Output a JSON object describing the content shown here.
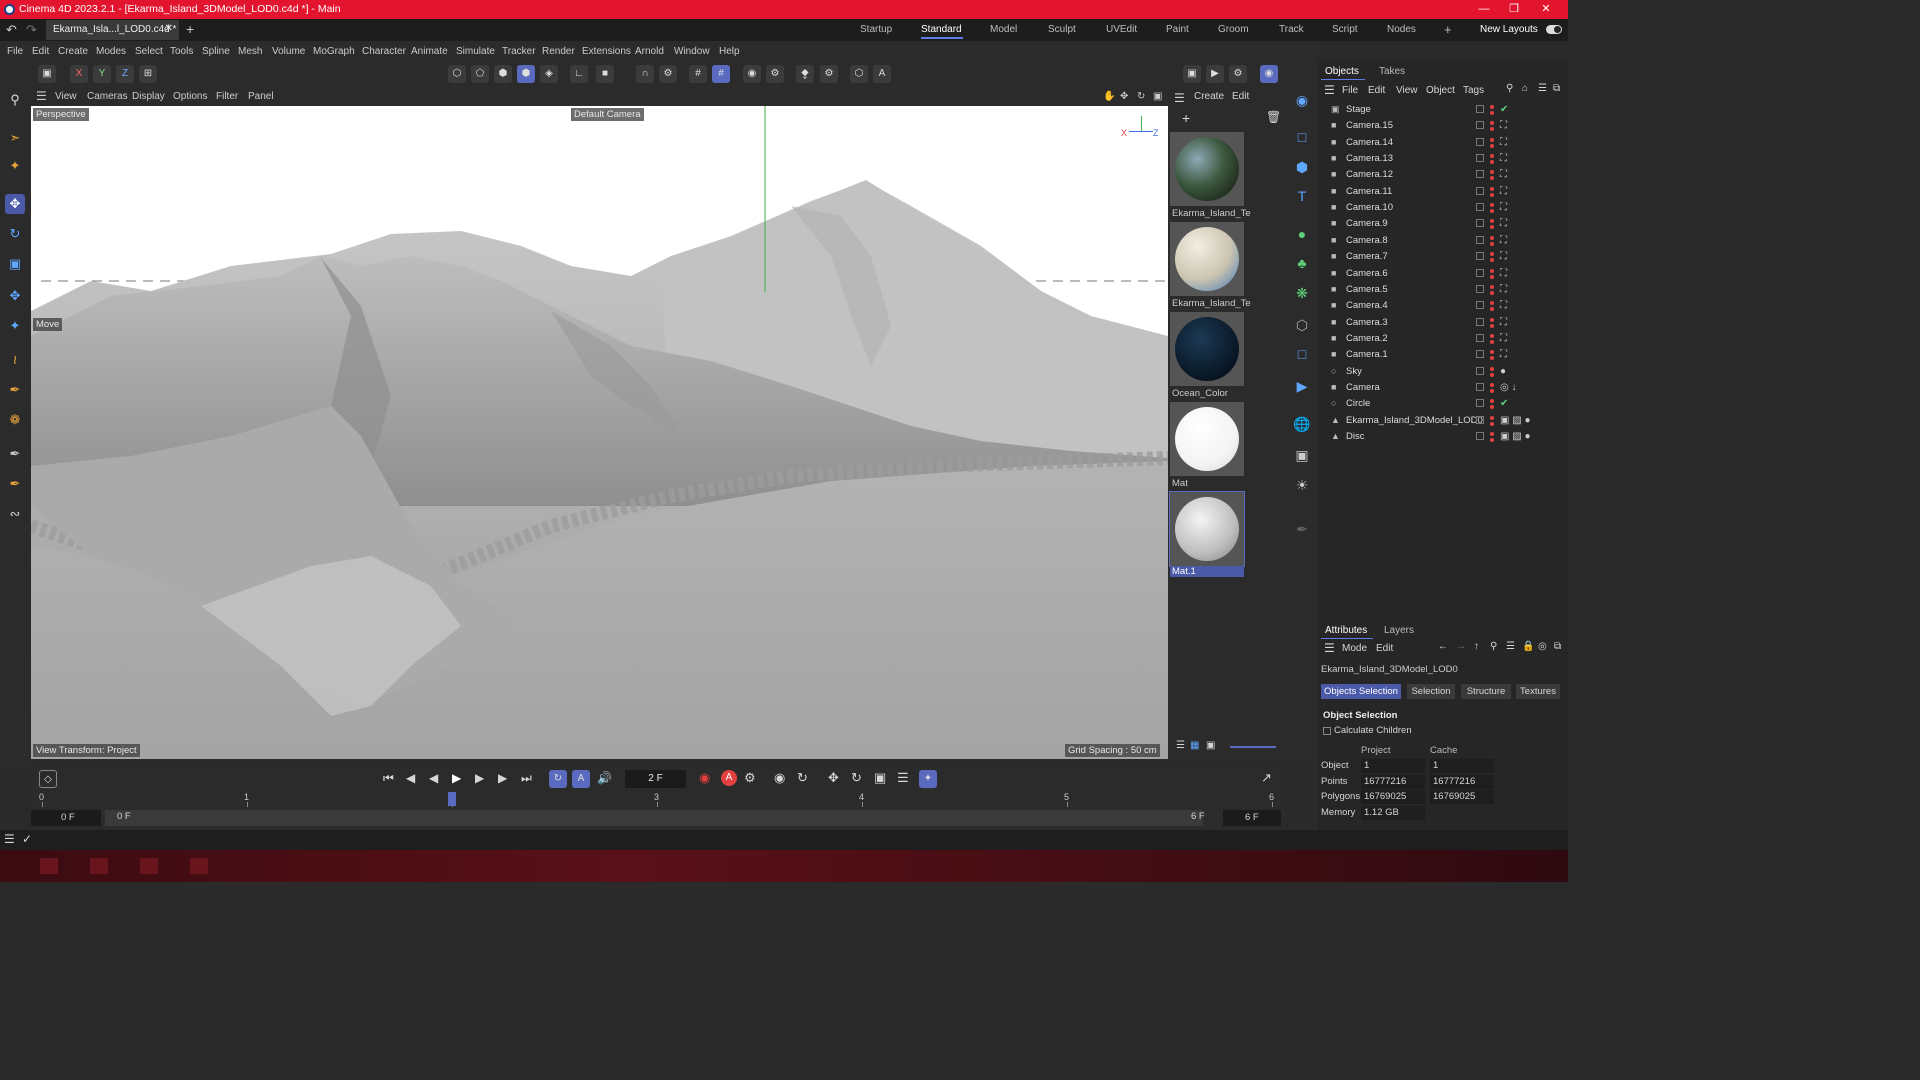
{
  "title_bar": {
    "title": "Cinema 4D 2023.2.1 - [Ekarma_Island_3DModel_LOD0.c4d *] - Main"
  },
  "doc_tab": {
    "label": "Ekarma_Isla...l_LOD0.c4d *"
  },
  "layouts": {
    "items": [
      "Startup",
      "Standard",
      "Model",
      "Sculpt",
      "UVEdit",
      "Paint",
      "Groom",
      "Track",
      "Script",
      "Nodes"
    ],
    "active": "Standard",
    "new_layouts": "New Layouts"
  },
  "menu": {
    "items": [
      "File",
      "Edit",
      "Create",
      "Modes",
      "Select",
      "Tools",
      "Spline",
      "Mesh",
      "Volume",
      "MoGraph",
      "Character",
      "Animate",
      "Simulate",
      "Tracker",
      "Render",
      "Extensions",
      "Arnold",
      "Window",
      "Help"
    ]
  },
  "axis_buttons": [
    "X",
    "Y",
    "Z"
  ],
  "viewport_menu": {
    "items": [
      "View",
      "Cameras",
      "Display",
      "Options",
      "Filter",
      "Panel"
    ]
  },
  "viewport": {
    "camera_label": "Perspective",
    "default_camera": "Default Camera",
    "move_label": "Move",
    "view_transform": "View Transform: Project",
    "grid_spacing": "Grid Spacing : 50 cm",
    "axis_x": "X",
    "axis_z": "Z"
  },
  "materials_panel": {
    "menu": [
      "Create",
      "Edit"
    ],
    "materials": [
      {
        "name": "Ekarma_Island_Te",
        "style": "island"
      },
      {
        "name": "Ekarma_Island_Te",
        "style": "island2"
      },
      {
        "name": "Ocean_Color",
        "style": "ocean"
      },
      {
        "name": "Mat",
        "style": "white"
      },
      {
        "name": "Mat.1",
        "style": "grey"
      }
    ]
  },
  "objects_panel": {
    "tabs": [
      "Objects",
      "Takes"
    ],
    "menu": [
      "File",
      "Edit",
      "View",
      "Object",
      "Tags"
    ],
    "objects": [
      {
        "name": "Stage",
        "icon": "stage-icon",
        "tag": "check"
      },
      {
        "name": "Camera.15",
        "icon": "camera-icon",
        "tag": "target"
      },
      {
        "name": "Camera.14",
        "icon": "camera-icon",
        "tag": "target"
      },
      {
        "name": "Camera.13",
        "icon": "camera-icon",
        "tag": "target"
      },
      {
        "name": "Camera.12",
        "icon": "camera-icon",
        "tag": "target"
      },
      {
        "name": "Camera.11",
        "icon": "camera-icon",
        "tag": "target"
      },
      {
        "name": "Camera.10",
        "icon": "camera-icon",
        "tag": "target"
      },
      {
        "name": "Camera.9",
        "icon": "camera-icon",
        "tag": "target"
      },
      {
        "name": "Camera.8",
        "icon": "camera-icon",
        "tag": "target"
      },
      {
        "name": "Camera.7",
        "icon": "camera-icon",
        "tag": "target"
      },
      {
        "name": "Camera.6",
        "icon": "camera-icon",
        "tag": "target"
      },
      {
        "name": "Camera.5",
        "icon": "camera-icon",
        "tag": "target"
      },
      {
        "name": "Camera.4",
        "icon": "camera-icon",
        "tag": "target"
      },
      {
        "name": "Camera.3",
        "icon": "camera-icon",
        "tag": "target"
      },
      {
        "name": "Camera.2",
        "icon": "camera-icon",
        "tag": "target"
      },
      {
        "name": "Camera.1",
        "icon": "camera-icon",
        "tag": "target"
      },
      {
        "name": "Sky",
        "icon": "sky-icon",
        "tag": "sphere"
      },
      {
        "name": "Camera",
        "icon": "camera-icon",
        "tag": "camera-tags"
      },
      {
        "name": "Circle",
        "icon": "circle-icon",
        "tag": "check"
      },
      {
        "name": "Ekarma_Island_3DModel_LOD0",
        "icon": "mesh-icon",
        "tag": "materials"
      },
      {
        "name": "Disc",
        "icon": "mesh-icon",
        "tag": "materials"
      }
    ]
  },
  "attributes_panel": {
    "tabs": [
      "Attributes",
      "Layers"
    ],
    "menu": [
      "Mode",
      "Edit"
    ],
    "object_name": "Ekarma_Island_3DModel_LOD0",
    "subtabs": [
      "Objects Selection",
      "Selection",
      "Structure",
      "Textures"
    ],
    "section_title": "Object Selection",
    "calculate_children": "Calculate Children",
    "columns": [
      "Project",
      "Cache"
    ],
    "rows": [
      {
        "label": "Object",
        "project": "1",
        "cache": "1"
      },
      {
        "label": "Points",
        "project": "16777216",
        "cache": "16777216"
      },
      {
        "label": "Polygons",
        "project": "16769025",
        "cache": "16769025"
      },
      {
        "label": "Memory",
        "project": "1.12 GB",
        "cache": ""
      }
    ]
  },
  "timeline": {
    "current_frame": "2 F",
    "ticks": [
      "0",
      "1",
      "2",
      "3",
      "4",
      "5",
      "6"
    ],
    "start_field": "0 F",
    "start_field2": "0 F",
    "end_field": "6 F",
    "end_field2": "6 F",
    "playhead_frame": 2
  }
}
